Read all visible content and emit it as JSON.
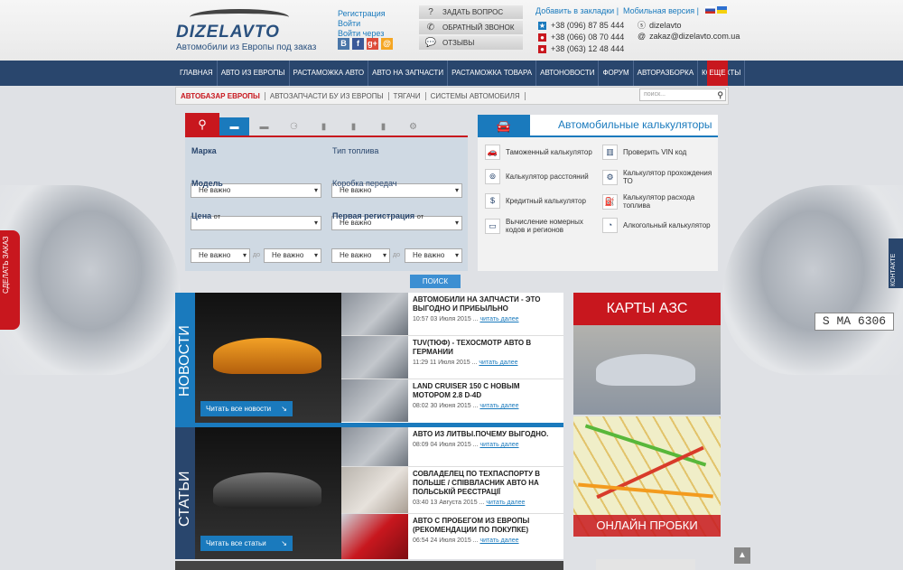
{
  "header": {
    "logo_text": "DIZELAVTO",
    "logo_sub": "Автомобили из Европы под заказ",
    "auth": [
      "Регистрация",
      "Войти",
      "Войти через"
    ],
    "social": [
      {
        "label": "В",
        "color": "#4a76a8"
      },
      {
        "label": "f",
        "color": "#3b5998"
      },
      {
        "label": "g+",
        "color": "#dd4b39"
      },
      {
        "label": "@",
        "color": "#f5a623"
      }
    ],
    "quick_buttons": [
      {
        "icon": "question-icon",
        "glyph": "?",
        "label": "ЗАДАТЬ ВОПРОС"
      },
      {
        "icon": "phone-icon",
        "glyph": "✆",
        "label": "ОБРАТНЫЙ ЗВОНОК"
      },
      {
        "icon": "chat-icon",
        "glyph": "💬",
        "label": "ОТЗЫВЫ"
      }
    ],
    "bookmark": "Добавить в закладки |",
    "mobile": "Мобильная версия |",
    "phones": [
      {
        "number": "+38 (096) 87 85 444",
        "color": "#1a7abd",
        "glyph": "★"
      },
      {
        "number": "+38 (066) 08 70 444",
        "color": "#c8171e",
        "glyph": "●"
      },
      {
        "number": "+38 (063) 12 48 444",
        "color": "#c8171e",
        "glyph": "●"
      }
    ],
    "skype": "dizelavto",
    "email": "zakaz@dizelavto.com.ua"
  },
  "nav": {
    "items": [
      "ГЛАВНАЯ",
      "АВТО ИЗ ЕВРОПЫ",
      "РАСТАМОЖКА АВТО",
      "АВТО НА ЗАПЧАСТИ",
      "РАСТАМОЖКА ТОВАРА",
      "АВТОНОВОСТИ",
      "ФОРУМ",
      "АВТОРАЗБОРКА",
      "КОНТАКТЫ"
    ],
    "more": "ЕЩЕ"
  },
  "subnav": {
    "items": [
      "АВТОБАЗАР ЕВРОПЫ",
      "АВТОЗАПЧАСТИ БУ ИЗ ЕВРОПЫ",
      "ТЯГАЧИ",
      "СИСТЕМЫ АВТОМОБИЛЯ"
    ],
    "search_placeholder": "поиск..."
  },
  "side": {
    "order": "СДЕЛАТЬ ЗАКАЗ",
    "vk": "КОНТАКТЕ"
  },
  "bg_plate": "S MA 6306",
  "search_panel": {
    "labels": {
      "make": "Марка",
      "fuel": "Тип топлива",
      "model": "Модель",
      "gearbox": "Коробка передач",
      "price": "Цена",
      "from": "от",
      "first_reg": "Первая  регистрация",
      "to": "до"
    },
    "default": "Не важно",
    "button": "ПОИСК"
  },
  "calculators": {
    "title": "Автомобильные калькуляторы",
    "items": [
      {
        "icon": "car-icon",
        "glyph": "🚗",
        "label": "Таможенный калькулятор"
      },
      {
        "icon": "barcode-icon",
        "glyph": "▥",
        "label": "Проверить VIN код"
      },
      {
        "icon": "binoculars-icon",
        "glyph": "⊚",
        "label": "Калькулятор расстояний"
      },
      {
        "icon": "gear-icon",
        "glyph": "⚙",
        "label": "Калькулятор прохождения ТО"
      },
      {
        "icon": "money-icon",
        "glyph": "$",
        "label": "Кредитный калькулятор"
      },
      {
        "icon": "fuel-icon",
        "glyph": "⛽",
        "label": "Калькулятор расхода топлива"
      },
      {
        "icon": "plate-icon",
        "glyph": "▭",
        "label": "Вычисление номерных кодов и регионов"
      },
      {
        "icon": "alcohol-icon",
        "glyph": "◔",
        "label": "Алкогольный калькулятор"
      }
    ]
  },
  "news": {
    "label": "НОВОСТИ",
    "all": "Читать все новости",
    "items": [
      {
        "title": "АВТОМОБИЛИ НА ЗАПЧАСТИ - ЭТО ВЫГОДНО И ПРИБЫЛЬНО",
        "meta": "10:57 03 Июля 2015 ...",
        "more": "читать далее"
      },
      {
        "title": "TUV(ТЮФ) - ТЕХОСМОТР АВТО В ГЕРМАНИИ",
        "meta": "11:29 11 Июля 2015 ...",
        "more": "читать далее"
      },
      {
        "title": "LAND CRUISER 150 С НОВЫМ МОТОРОМ 2.8 D-4D",
        "meta": "08:02 30 Июня 2015 ...",
        "more": "читать далее"
      }
    ]
  },
  "articles": {
    "label": "СТАТЬИ",
    "all": "Читать все статьи",
    "items": [
      {
        "title": "АВТО ИЗ ЛИТВЫ.ПОЧЕМУ ВЫГОДНО.",
        "meta": "08:09 04 Июля 2015 ...",
        "more": "читать далее"
      },
      {
        "title": "СОВЛАДЕЛЕЦ ПО ТЕХПАСПОРТУ В ПОЛЬШЕ / СПІВВЛАСНИК АВТО НА ПОЛЬСЬКІЙ РЕЄСТРАЦІЇ",
        "meta": "03:40 13 Августа 2015 ...",
        "more": "читать далее"
      },
      {
        "title": "АВТО С ПРОБЕГОМ ИЗ ЕВРОПЫ (РЕКОМЕНДАЦИИ ПО ПОКУПКЕ)",
        "meta": "06:54 24 Июля 2015 ...",
        "more": "читать далее"
      }
    ]
  },
  "promo": {
    "azs": "КАРТЫ АЗС",
    "traffic": "ОНЛАЙН ПРОБКИ"
  },
  "colors": {
    "brand_blue": "#29466d",
    "accent_red": "#c8171e",
    "link_blue": "#1a7abd"
  }
}
